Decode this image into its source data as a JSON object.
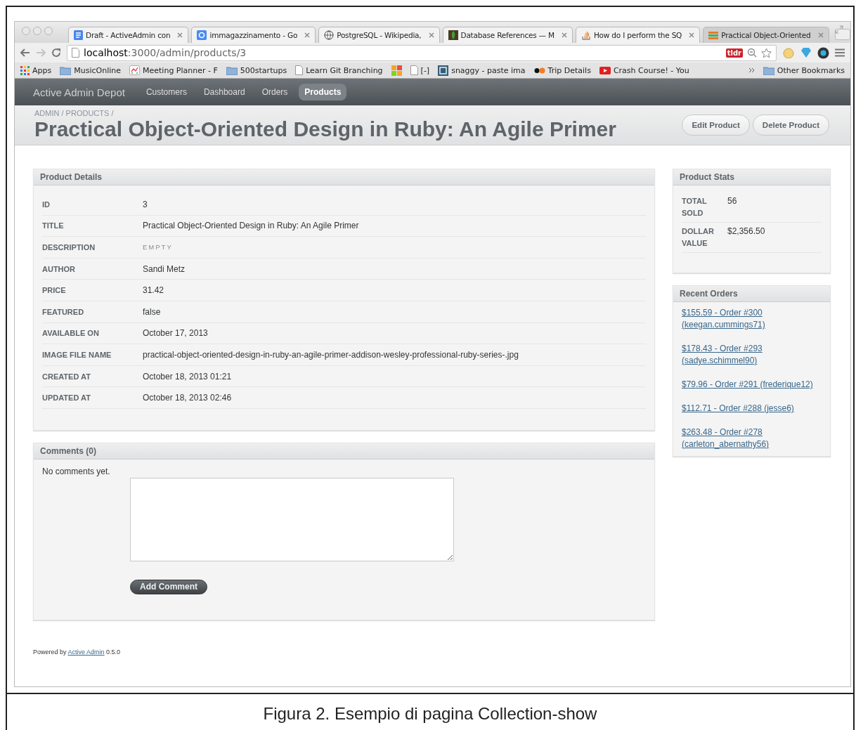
{
  "browser": {
    "tabs": [
      {
        "title": "Draft - ActiveAdmin con",
        "selected": false
      },
      {
        "title": "immagazzinamento - Go",
        "selected": false
      },
      {
        "title": "PostgreSQL - Wikipedia,",
        "selected": false
      },
      {
        "title": "Database References — M",
        "selected": false
      },
      {
        "title": "How do I perform the SQ",
        "selected": false
      },
      {
        "title": "Practical Object-Oriented",
        "selected": true
      }
    ],
    "address": {
      "host": "localhost",
      "path": ":3000/admin/products/3"
    },
    "badge": "tldr",
    "bookmarks": [
      {
        "kind": "link",
        "label": "Apps"
      },
      {
        "kind": "link",
        "label": "MusicOnline"
      },
      {
        "kind": "link",
        "label": "Meeting Planner - F"
      },
      {
        "kind": "link",
        "label": "500startups"
      },
      {
        "kind": "link",
        "label": "Learn Git Branching"
      },
      {
        "kind": "icon"
      },
      {
        "kind": "link",
        "label": "[-]"
      },
      {
        "kind": "link",
        "label": "snaggy - paste ima"
      },
      {
        "kind": "link",
        "label": "Trip Details"
      },
      {
        "kind": "link",
        "label": "Crash Course! - You"
      }
    ],
    "other_bookmarks": "Other Bookmarks"
  },
  "admin": {
    "site_title": "Active Admin Depot",
    "nav": [
      {
        "label": "Customers",
        "selected": false
      },
      {
        "label": "Dashboard",
        "selected": false
      },
      {
        "label": "Orders",
        "selected": false
      },
      {
        "label": "Products",
        "selected": true
      }
    ],
    "breadcrumb": "ADMIN / PRODUCTS /",
    "page_title": "Practical Object-Oriented Design in Ruby: An Agile Primer",
    "actions": [
      "Edit Product",
      "Delete Product"
    ],
    "details": {
      "title": "Product Details",
      "rows": [
        {
          "label": "ID",
          "value": "3",
          "empty": false
        },
        {
          "label": "TITLE",
          "value": "Practical Object-Oriented Design in Ruby: An Agile Primer",
          "empty": false
        },
        {
          "label": "DESCRIPTION",
          "value": "EMPTY",
          "empty": true
        },
        {
          "label": "AUTHOR",
          "value": "Sandi Metz",
          "empty": false
        },
        {
          "label": "PRICE",
          "value": "31.42",
          "empty": false
        },
        {
          "label": "FEATURED",
          "value": "false",
          "empty": false
        },
        {
          "label": "AVAILABLE ON",
          "value": "October 17, 2013",
          "empty": false
        },
        {
          "label": "IMAGE FILE NAME",
          "value": "practical-object-oriented-design-in-ruby-an-agile-primer-addison-wesley-professional-ruby-series-.jpg",
          "empty": false
        },
        {
          "label": "CREATED AT",
          "value": "October 18, 2013 01:21",
          "empty": false
        },
        {
          "label": "UPDATED AT",
          "value": "October 18, 2013 02:46",
          "empty": false
        }
      ]
    },
    "comments": {
      "title": "Comments (0)",
      "message": "No comments yet.",
      "button": "Add Comment"
    },
    "stats": {
      "title": "Product Stats",
      "rows": [
        {
          "label": "TOTAL SOLD",
          "value": "56"
        },
        {
          "label": "DOLLAR VALUE",
          "value": "$2,356.50"
        }
      ]
    },
    "recent_orders": {
      "title": "Recent Orders",
      "links": [
        "$155.59 - Order #300 (keegan.cummings71)",
        "$178.43 - Order #293 (sadye.schimmel90)",
        "$79.96 - Order #291 (frederique12)",
        "$112.71 - Order #288 (jesse6)",
        "$263.48 - Order #278 (carleton_abernathy56)"
      ]
    },
    "footer": {
      "before": "Powered by",
      "link": "Active Admin",
      "after": "0.5.0"
    }
  },
  "caption": "Figura 2. Esempio di pagina Collection-show"
}
